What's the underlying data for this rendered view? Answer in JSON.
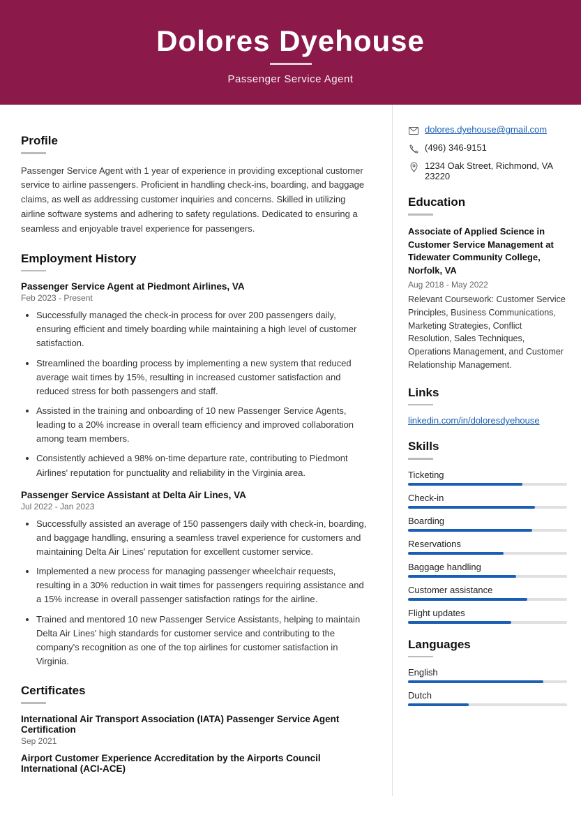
{
  "header": {
    "name": "Dolores Dyehouse",
    "underline": "",
    "title": "Passenger Service Agent"
  },
  "contact": {
    "email": "dolores.dyehouse@gmail.com",
    "phone": "(496) 346-9151",
    "address": "1234 Oak Street, Richmond, VA 23220"
  },
  "profile": {
    "section_title": "Profile",
    "text": "Passenger Service Agent with 1 year of experience in providing exceptional customer service to airline passengers. Proficient in handling check-ins, boarding, and baggage claims, as well as addressing customer inquiries and concerns. Skilled in utilizing airline software systems and adhering to safety regulations. Dedicated to ensuring a seamless and enjoyable travel experience for passengers."
  },
  "employment": {
    "section_title": "Employment History",
    "jobs": [
      {
        "title": "Passenger Service Agent at Piedmont Airlines, VA",
        "dates": "Feb 2023 - Present",
        "bullets": [
          "Successfully managed the check-in process for over 200 passengers daily, ensuring efficient and timely boarding while maintaining a high level of customer satisfaction.",
          "Streamlined the boarding process by implementing a new system that reduced average wait times by 15%, resulting in increased customer satisfaction and reduced stress for both passengers and staff.",
          "Assisted in the training and onboarding of 10 new Passenger Service Agents, leading to a 20% increase in overall team efficiency and improved collaboration among team members.",
          "Consistently achieved a 98% on-time departure rate, contributing to Piedmont Airlines' reputation for punctuality and reliability in the Virginia area."
        ]
      },
      {
        "title": "Passenger Service Assistant at Delta Air Lines, VA",
        "dates": "Jul 2022 - Jan 2023",
        "bullets": [
          "Successfully assisted an average of 150 passengers daily with check-in, boarding, and baggage handling, ensuring a seamless travel experience for customers and maintaining Delta Air Lines' reputation for excellent customer service.",
          "Implemented a new process for managing passenger wheelchair requests, resulting in a 30% reduction in wait times for passengers requiring assistance and a 15% increase in overall passenger satisfaction ratings for the airline.",
          "Trained and mentored 10 new Passenger Service Assistants, helping to maintain Delta Air Lines' high standards for customer service and contributing to the company's recognition as one of the top airlines for customer satisfaction in Virginia."
        ]
      }
    ]
  },
  "certificates": {
    "section_title": "Certificates",
    "items": [
      {
        "title": "International Air Transport Association (IATA) Passenger Service Agent Certification",
        "date": "Sep 2021"
      },
      {
        "title": "Airport Customer Experience Accreditation by the Airports Council International (ACI-ACE)",
        "date": ""
      }
    ]
  },
  "education": {
    "section_title": "Education",
    "degree": "Associate of Applied Science in Customer Service Management at Tidewater Community College, Norfolk, VA",
    "dates": "Aug 2018 - May 2022",
    "coursework": "Relevant Coursework: Customer Service Principles, Business Communications, Marketing Strategies, Conflict Resolution, Sales Techniques, Operations Management, and Customer Relationship Management."
  },
  "links": {
    "section_title": "Links",
    "items": [
      {
        "label": "linkedin.com/in/doloresdyehouse",
        "url": "#"
      }
    ]
  },
  "skills": {
    "section_title": "Skills",
    "items": [
      {
        "name": "Ticketing",
        "percent": 72
      },
      {
        "name": "Check-in",
        "percent": 80
      },
      {
        "name": "Boarding",
        "percent": 78
      },
      {
        "name": "Reservations",
        "percent": 60
      },
      {
        "name": "Baggage handling",
        "percent": 68
      },
      {
        "name": "Customer assistance",
        "percent": 75
      },
      {
        "name": "Flight updates",
        "percent": 65
      }
    ]
  },
  "languages": {
    "section_title": "Languages",
    "items": [
      {
        "name": "English",
        "percent": 85
      },
      {
        "name": "Dutch",
        "percent": 38
      }
    ]
  }
}
